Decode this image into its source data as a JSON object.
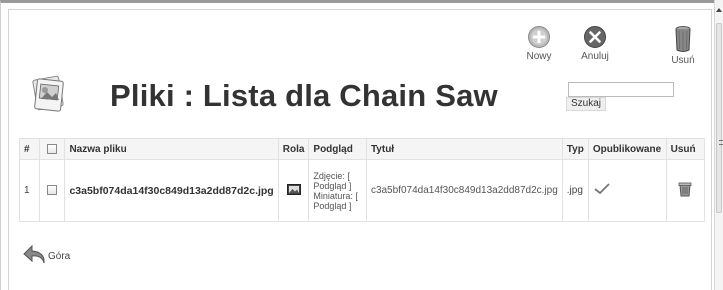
{
  "header": {
    "title": "Pliki : Lista dla Chain Saw"
  },
  "toolbar": {
    "new_label": "Nowy",
    "cancel_label": "Anuluj",
    "delete_label": "Usuń"
  },
  "search": {
    "value": "",
    "button_label": "Szukaj"
  },
  "table": {
    "columns": [
      "#",
      "",
      "Nazwa pliku",
      "Rola",
      "Podgląd",
      "Tytuł",
      "Typ",
      "Opublikowane",
      "Usuń"
    ],
    "rows": [
      {
        "index": "1",
        "filename": "c3a5bf074da14f30c849d13a2dd87d2c.jpg",
        "role_icon": "image-icon",
        "preview_line1": "Zdjęcie: [",
        "preview_line2": "Podgląd ]",
        "preview_line3": "Miniatura: [",
        "preview_line4": "Podgląd ]",
        "title": "c3a5bf074da14f30c849d13a2dd87d2c.jpg",
        "type": ".jpg",
        "published_icon": "check-icon",
        "delete_icon": "trash-icon"
      }
    ]
  },
  "footer": {
    "top_label": "Góra"
  }
}
